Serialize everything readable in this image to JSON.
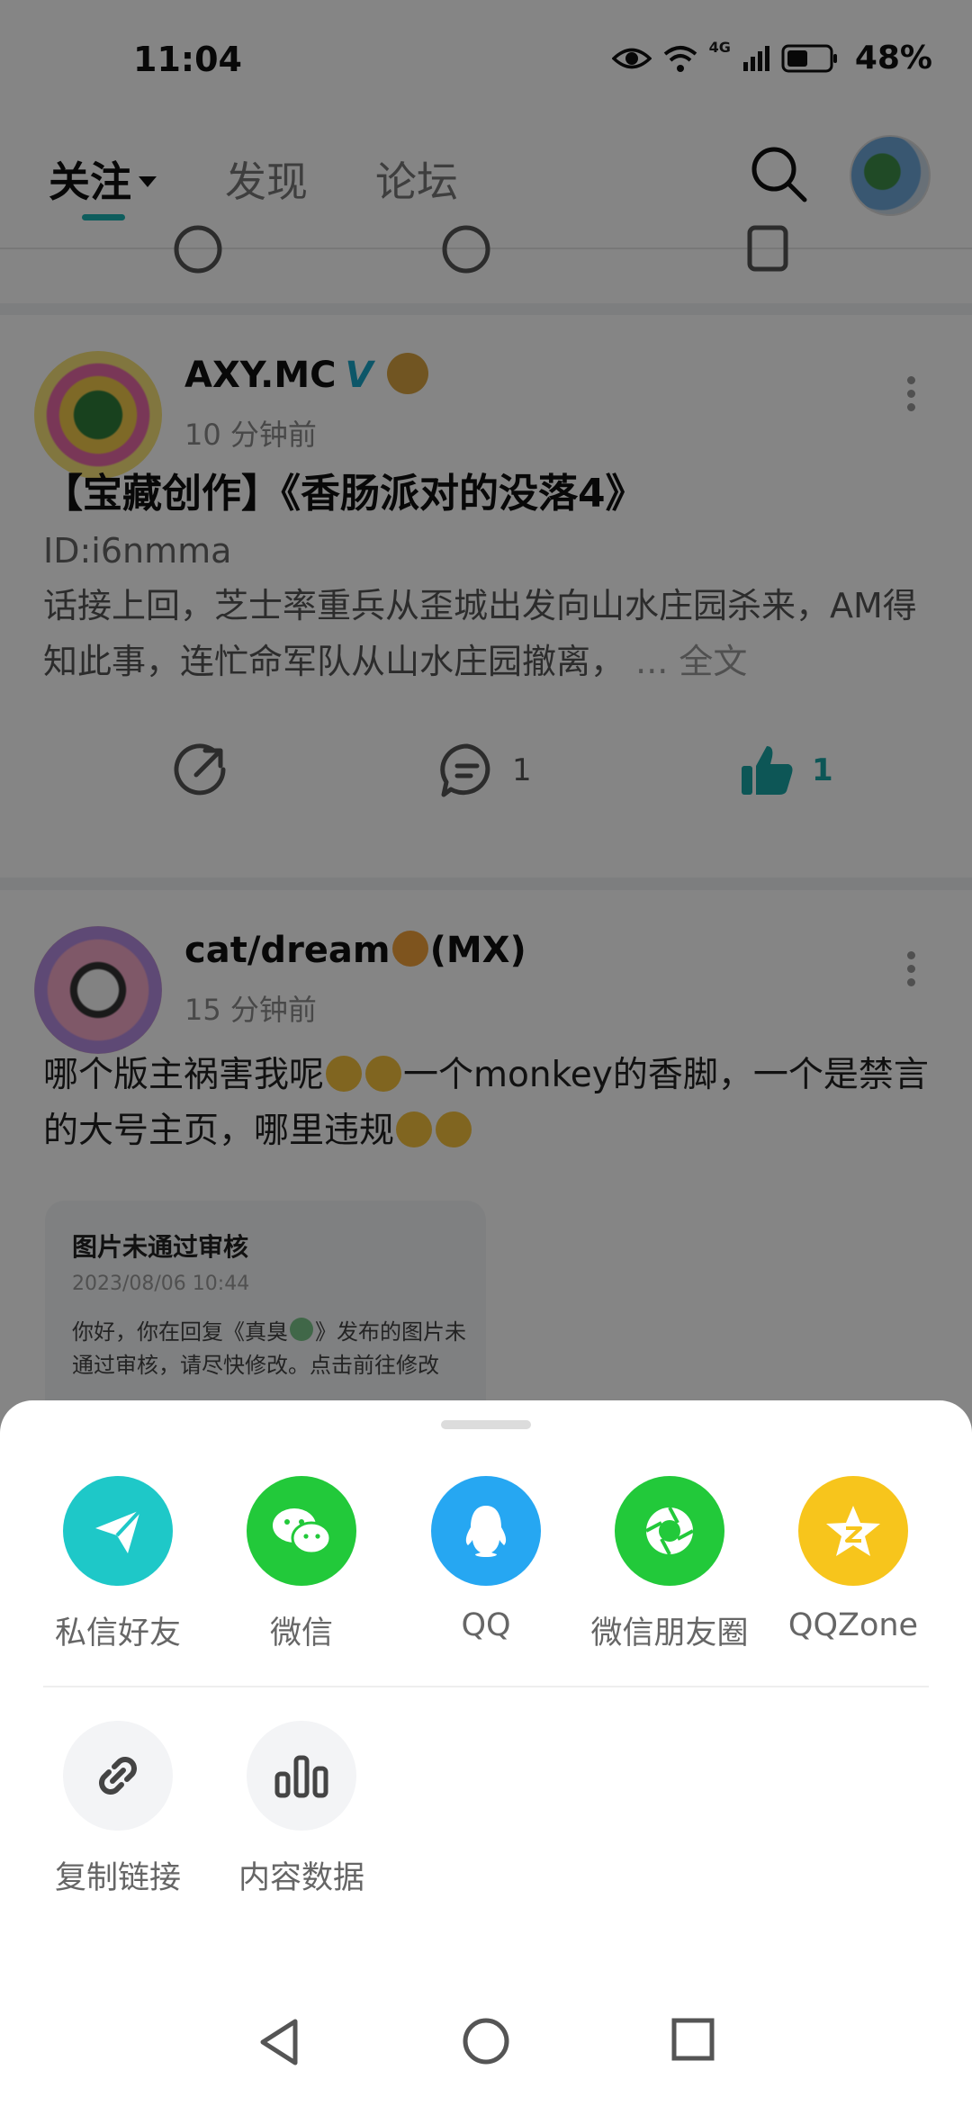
{
  "status_bar": {
    "time": "11:04",
    "network": "4G",
    "battery": "48%"
  },
  "top_nav": {
    "tabs": [
      {
        "label": "关注",
        "active": true
      },
      {
        "label": "发现",
        "active": false
      },
      {
        "label": "论坛",
        "active": false
      }
    ],
    "accent_color": "#1bb3b3"
  },
  "posts": [
    {
      "username": "AXY.MC",
      "verified_mark": "V",
      "time": "10 分钟前",
      "title": "【宝藏创作】《香肠派对的没落4》",
      "id_line": "ID:i6nmma",
      "body": "话接上回，芝士率重兵从歪城出发向山水庄园杀来，AM得知此事，连忙命军队从山水庄园撤离，",
      "read_more": "... 全文",
      "comments": "1",
      "likes": "1"
    },
    {
      "username_prefix": "cat/dream",
      "username_suffix": "(MX)",
      "time": "15 分钟前",
      "text_part1": "哪个版主祸害我呢",
      "text_part2": "一个monkey的香脚，一个是禁言的大号主页，哪里违规",
      "notice": {
        "title": "图片未通过审核",
        "date": "2023/08/06 10:44",
        "body_part1": "你好，你在回复《真臭",
        "body_part2": "》发布的图片未通过审核，请尽快修改。点击前往修改"
      }
    }
  ],
  "share_sheet": {
    "row1": [
      {
        "label": "私信好友",
        "icon": "paper-plane-icon",
        "color": "#1ec8c8"
      },
      {
        "label": "微信",
        "icon": "wechat-icon",
        "color": "#22c93a"
      },
      {
        "label": "QQ",
        "icon": "qq-penguin-icon",
        "color": "#26a7f2"
      },
      {
        "label": "微信朋友圈",
        "icon": "moments-icon",
        "color": "#22c93a"
      },
      {
        "label": "QQZone",
        "icon": "qzone-star-icon",
        "color": "#f7c51c"
      }
    ],
    "row2": [
      {
        "label": "复制链接",
        "icon": "link-icon",
        "color": "#f3f4f6"
      },
      {
        "label": "内容数据",
        "icon": "bar-chart-icon",
        "color": "#f3f4f6"
      }
    ]
  }
}
